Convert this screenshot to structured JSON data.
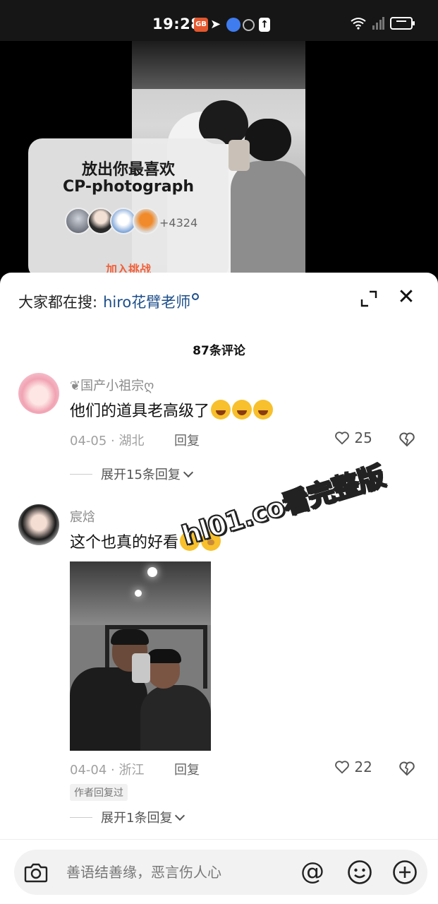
{
  "status_bar": {
    "time": "19:28",
    "app_icon_label": "GB"
  },
  "video": {
    "challenge": {
      "title_line1": "放出你最喜欢",
      "title_line2": "CP-photograph",
      "participants": "+4324",
      "join_label": "加入挑战"
    }
  },
  "sheet": {
    "search_prefix": "大家都在搜:",
    "search_keyword": "hiro花臂老师",
    "comment_count": "87条评论",
    "comments": [
      {
        "username": "❦国产小祖宗ღ",
        "text": "他们的道具老高级了",
        "date_location": "04-05 · 湖北",
        "reply_label": "回复",
        "likes": "25",
        "expand": "展开15条回复"
      },
      {
        "username": "宸焓",
        "text": "这个也真的好看",
        "date_location": "04-04 · 浙江",
        "reply_label": "回复",
        "likes": "22",
        "author_badge": "作者回复过",
        "expand": "展开1条回复"
      }
    ]
  },
  "watermark": "hl01.co看完整版",
  "input": {
    "placeholder": "善语结善缘，恶言伤人心",
    "at_symbol": "@"
  }
}
